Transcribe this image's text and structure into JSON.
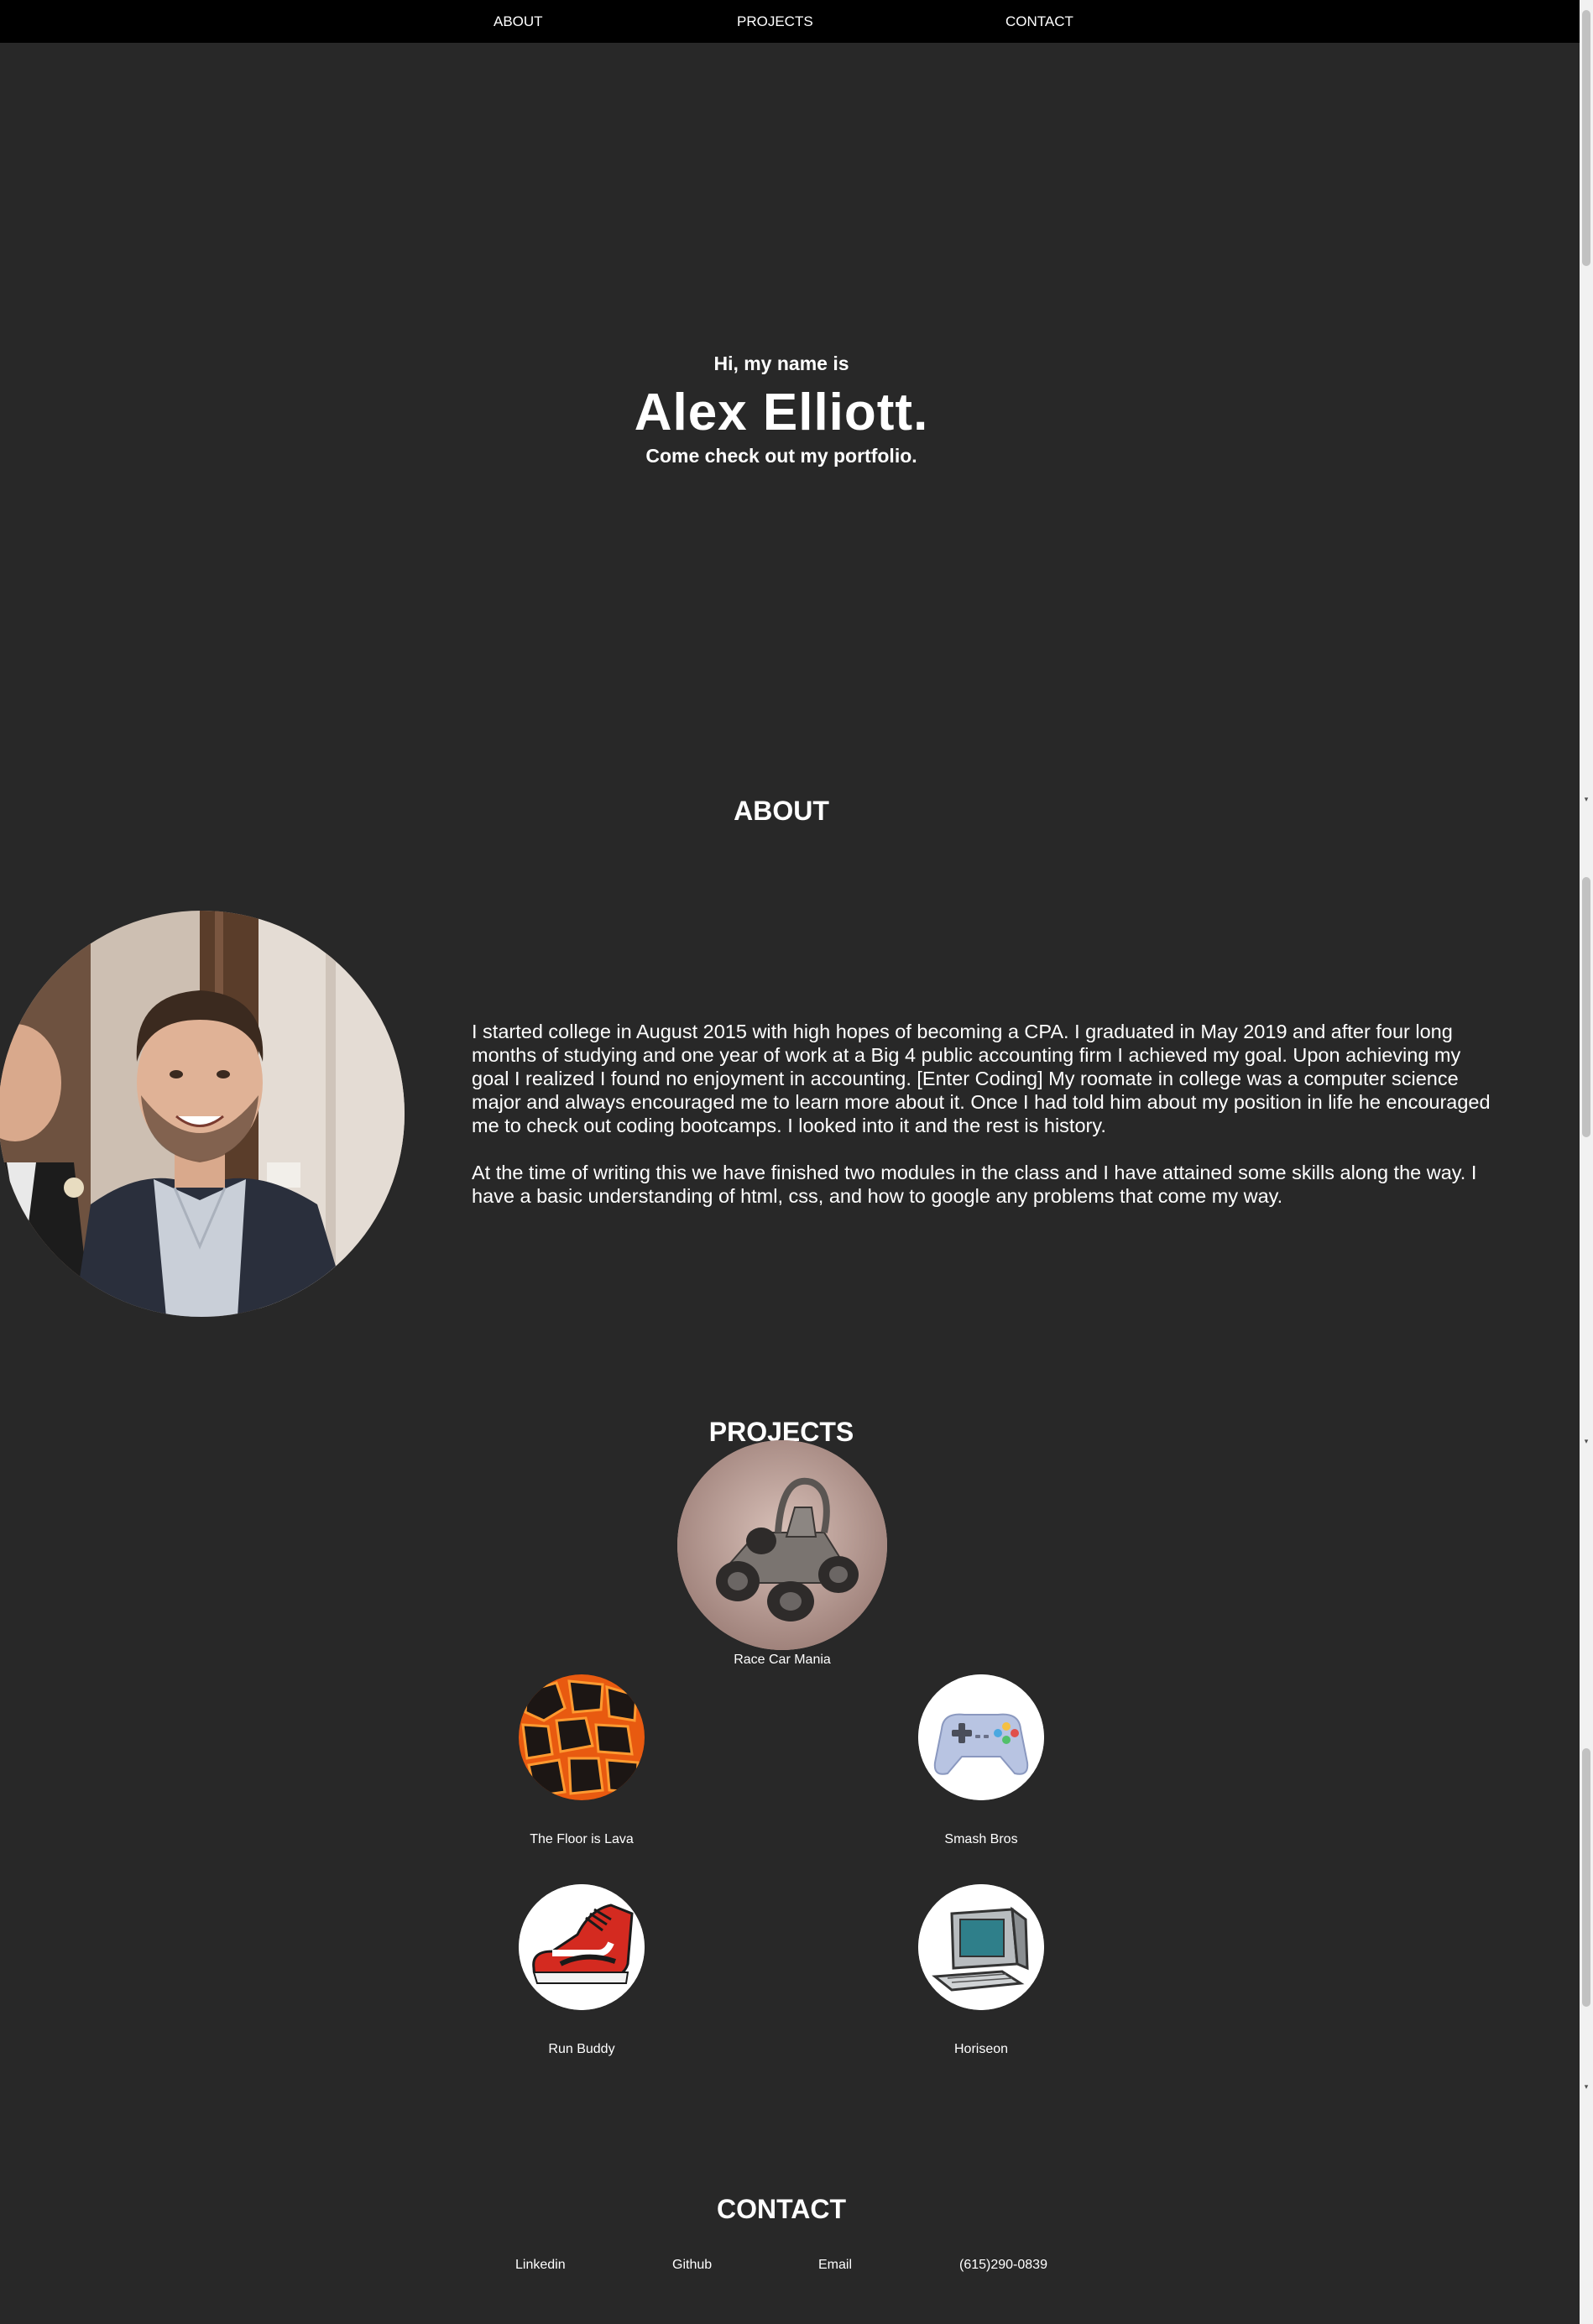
{
  "nav": {
    "about": "ABOUT",
    "projects": "PROJECTS",
    "contact": "CONTACT"
  },
  "hero": {
    "greeting": "Hi, my name is",
    "name": "Alex Elliott.",
    "tagline": "Come check out my portfolio."
  },
  "about": {
    "title": "ABOUT",
    "paragraphs": [
      "I started college in August 2015 with high hopes of becoming a CPA. I graduated in May 2019 and after four long months of studying and one year of work at a Big 4 public accounting firm I achieved my goal. Upon achieving my goal I realized I found no enjoyment in accounting. [Enter Coding] My roomate in college was a computer science major and always encouraged me to learn more about it. Once I had told him about my position in life he encouraged me to check out coding bootcamps. I looked into it and the rest is history.",
      "At the time of writing this we have finished two modules in the class and I have attained some skills along the way. I have a basic understanding of html, css, and how to google any problems that come my way."
    ]
  },
  "projects": {
    "title": "PROJECTS",
    "items": [
      {
        "label": "Race Car Mania",
        "icon": "race-car-icon"
      },
      {
        "label": "The Floor is Lava",
        "icon": "lava-icon"
      },
      {
        "label": "Smash Bros",
        "icon": "game-controller-icon"
      },
      {
        "label": "Run Buddy",
        "icon": "sneaker-icon"
      },
      {
        "label": "Horiseon",
        "icon": "computer-icon"
      }
    ]
  },
  "contact": {
    "title": "CONTACT",
    "linkedin": "Linkedin",
    "github": "Github",
    "email": "Email",
    "phone": "(615)290-0839"
  },
  "colors": {
    "background": "#282828",
    "nav_background": "#000000",
    "text": "#ffffff"
  }
}
